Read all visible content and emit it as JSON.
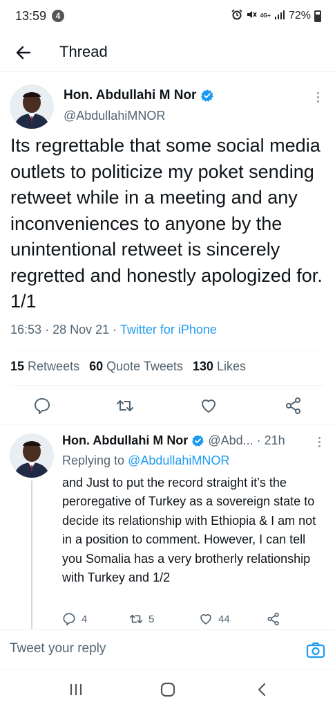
{
  "status_bar": {
    "time": "13:59",
    "notification_count": "4",
    "network": "4G+",
    "battery": "72%"
  },
  "header": {
    "title": "Thread"
  },
  "main_tweet": {
    "display_name": "Hon. Abdullahi M Nor",
    "handle": "@AbdullahiMNOR",
    "text": "Its regrettable that some social media outlets to politicize my poket sending retweet while in a meeting and any inconveniences to anyone by the unintentional retweet is sincerely regretted and honestly apologized for. 1/1",
    "time": "16:53",
    "date": "28 Nov 21",
    "source": "Twitter for iPhone",
    "retweets_count": "15",
    "retweets_label": "Retweets",
    "quotes_count": "60",
    "quotes_label": "Quote Tweets",
    "likes_count": "130",
    "likes_label": "Likes"
  },
  "reply_tweet": {
    "display_name": "Hon. Abdullahi M Nor",
    "handle": "@Abd...",
    "time": "21h",
    "replying_to_label": "Replying to",
    "replying_to_handle": "@AbdullahiMNOR",
    "text": "and Just to put the record straight it’s the peroregative of Turkey as a sovereign state to decide its relationship with Ethiopia & I am not in a position to comment. However, I can tell you Somalia has a very brotherly relationship with Turkey and 1/2",
    "replies_count": "4",
    "retweets_count": "5",
    "likes_count": "44"
  },
  "composer": {
    "placeholder": "Tweet your reply"
  },
  "colors": {
    "accent": "#1d9bf0",
    "secondary_text": "#536471",
    "primary_text": "#0f1419",
    "divider": "#eff3f4"
  },
  "icons": {
    "back": "arrow-left-icon",
    "verified": "verified-badge-icon",
    "more": "more-vertical-icon",
    "reply": "comment-icon",
    "retweet": "retweet-icon",
    "like": "heart-icon",
    "share": "share-icon",
    "camera": "camera-icon",
    "nav_recents": "recents-icon",
    "nav_home": "home-icon",
    "nav_back": "nav-back-icon"
  }
}
